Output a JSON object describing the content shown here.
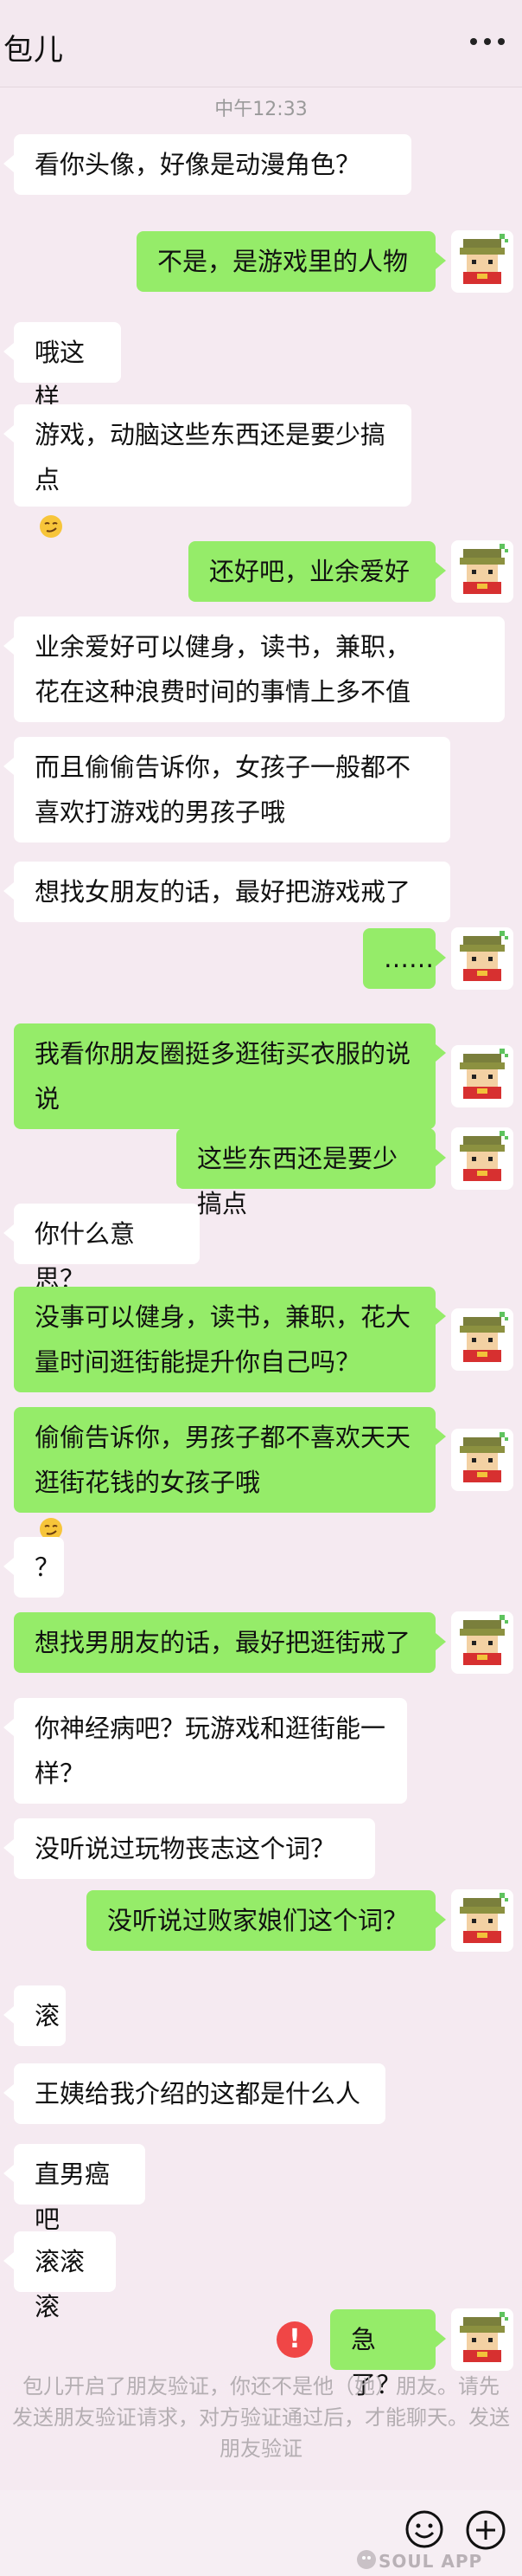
{
  "header": {
    "contact_name": "包儿"
  },
  "timestamp": "中午12:33",
  "messages": [
    {
      "side": "left",
      "text": "看你头像，好像是动漫角色？"
    },
    {
      "side": "right",
      "text": "不是，是游戏里的人物"
    },
    {
      "side": "left",
      "text": "哦这样"
    },
    {
      "side": "left",
      "text": "游戏，动脑这些东西还是要少搞点",
      "emoji": "smirk-emoji"
    },
    {
      "side": "right",
      "text": "还好吧，业余爱好"
    },
    {
      "side": "left",
      "text": "业余爱好可以健身，读书，兼职，\n花在这种浪费时间的事情上多不值"
    },
    {
      "side": "left",
      "text": "而且偷偷告诉你，女孩子一般都不\n喜欢打游戏的男孩子哦"
    },
    {
      "side": "left",
      "text": "想找女朋友的话，最好把游戏戒了"
    },
    {
      "side": "right",
      "text": "……"
    },
    {
      "side": "right",
      "text": "我看你朋友圈挺多逛街买衣服的说\n说"
    },
    {
      "side": "right",
      "text": "这些东西还是要少搞点"
    },
    {
      "side": "left",
      "text": "你什么意思？"
    },
    {
      "side": "right",
      "text": "没事可以健身，读书，兼职，花大\n量时间逛街能提升你自己吗？"
    },
    {
      "side": "right",
      "text": "偷偷告诉你，男孩子都不喜欢天天\n逛街花钱的女孩子哦",
      "emoji": "smirk-emoji"
    },
    {
      "side": "left",
      "text": "？"
    },
    {
      "side": "right",
      "text": "想找男朋友的话，最好把逛街戒了"
    },
    {
      "side": "left",
      "text": "你神经病吧？玩游戏和逛街能一\n样？"
    },
    {
      "side": "left",
      "text": "没听说过玩物丧志这个词？"
    },
    {
      "side": "right",
      "text": "没听说过败家娘们这个词？"
    },
    {
      "side": "left",
      "text": "滚"
    },
    {
      "side": "left",
      "text": "王姨给我介绍的这都是什么人"
    },
    {
      "side": "left",
      "text": "直男癌吧"
    },
    {
      "side": "left",
      "text": "滚滚滚"
    },
    {
      "side": "right",
      "text": "急了？",
      "failed": true
    }
  ],
  "failed_indicator": "!",
  "system_notice": {
    "line1": "包儿开启了朋友验证，你还不是他（她）朋友。请先",
    "line2": "发送朋友验证请求，对方验证通过后，才能聊天。发送",
    "line3": "朋友验证"
  },
  "watermark": "SOUL APP",
  "icons": {
    "more": "more-dots-icon",
    "emoji": "emoji-face-icon",
    "add": "add-circle-icon",
    "avatar": "pixel-character-avatar"
  },
  "colors": {
    "sent_bubble": "#95ec69",
    "received_bubble": "#ffffff",
    "background": "#f5eaf1",
    "error": "#f04646"
  }
}
